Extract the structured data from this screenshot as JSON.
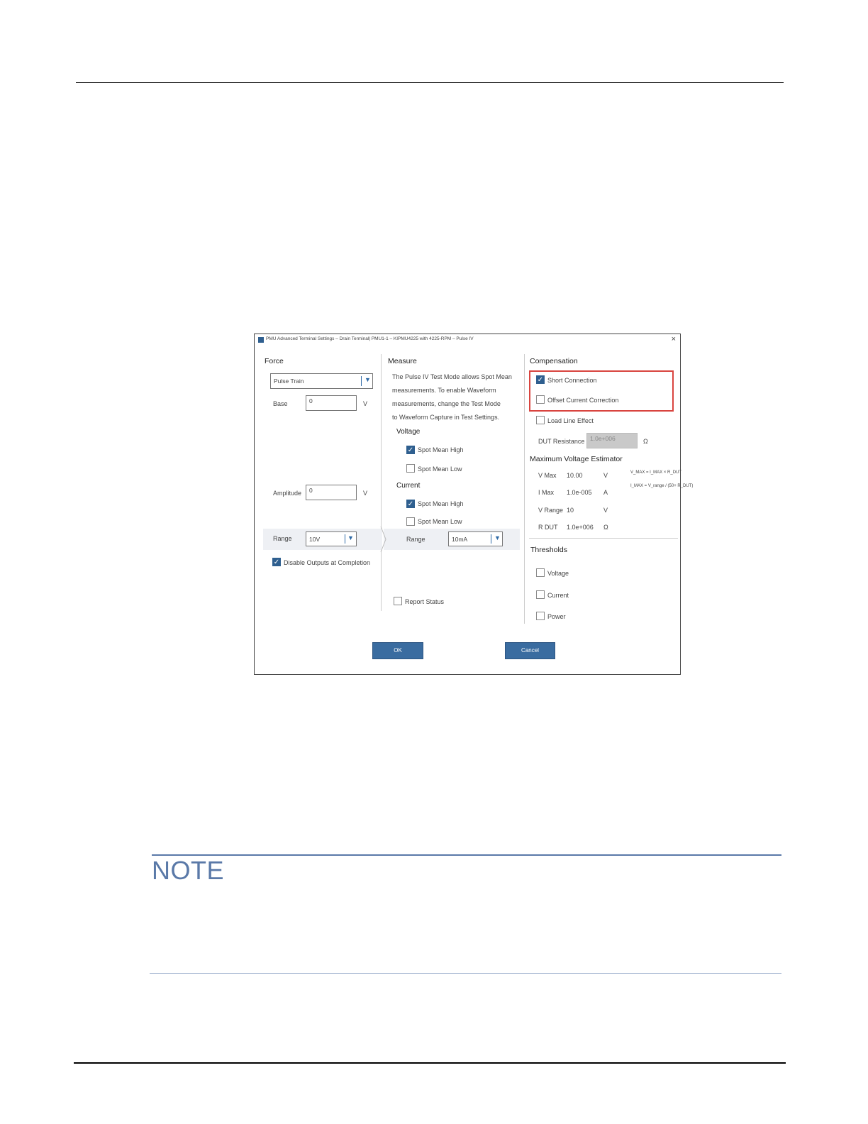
{
  "dialog": {
    "title": "PMU Advanced Terminal Settings – Drain Terminal| PMU1-1 – KIPMU4225 with 4225-RPM – Pulse IV",
    "close_glyph": "×",
    "force": {
      "heading": "Force",
      "pulse_type": "Pulse Train",
      "base_label": "Base",
      "base_value": "0",
      "base_unit": "V",
      "amplitude_label": "Amplitude",
      "amplitude_value": "0",
      "amplitude_unit": "V",
      "range_label": "Range",
      "range_value": "10V",
      "disable_outputs_label": "Disable Outputs at Completion"
    },
    "measure": {
      "heading": "Measure",
      "info_lines": [
        "The Pulse IV Test Mode allows Spot Mean",
        "measurements. To enable Waveform",
        "measurements, change the Test Mode",
        "to Waveform Capture in Test Settings."
      ],
      "voltage_heading": "Voltage",
      "v_spot_mean_high": "Spot Mean High",
      "v_spot_mean_low": "Spot Mean Low",
      "current_heading": "Current",
      "i_spot_mean_high": "Spot Mean High",
      "i_spot_mean_low": "Spot Mean Low",
      "range_label": "Range",
      "range_value": "10mA",
      "report_status_label": "Report Status"
    },
    "compensation": {
      "heading": "Compensation",
      "short_connection": "Short Connection",
      "offset_current_correction": "Offset Current Correction",
      "load_line_effect": "Load Line Effect",
      "dut_resistance_label": "DUT Resistance",
      "dut_resistance_value": "1.0e+006",
      "dut_resistance_unit": "Ω"
    },
    "estimator": {
      "heading": "Maximum Voltage Estimator",
      "rows": [
        {
          "label": "V Max",
          "value": "10.00",
          "unit": "V"
        },
        {
          "label": "I Max",
          "value": "1.0e-005",
          "unit": "A"
        },
        {
          "label": "V Range",
          "value": "10",
          "unit": "V"
        },
        {
          "label": "R DUT",
          "value": "1.0e+006",
          "unit": "Ω"
        }
      ],
      "formula_1": "V_MAX = I_MAX × R_DUT",
      "formula_2": "I_MAX = V_range / (50+ R_DUT)"
    },
    "thresholds": {
      "heading": "Thresholds",
      "voltage": "Voltage",
      "current": "Current",
      "power": "Power"
    },
    "ok_label": "OK",
    "cancel_label": "Cancel"
  },
  "note": {
    "heading": "NOTE"
  },
  "colors": {
    "accent": "#2f5f8f",
    "highlight": "#d9443f",
    "note_blue": "#5a79a8"
  }
}
